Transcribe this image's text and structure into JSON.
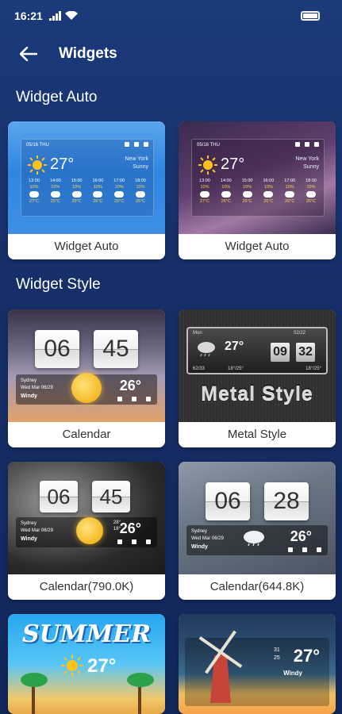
{
  "status_bar": {
    "time": "16:21"
  },
  "header": {
    "title": "Widgets"
  },
  "sections": {
    "widget_auto": {
      "title": "Widget Auto"
    },
    "widget_style": {
      "title": "Widget Style"
    }
  },
  "auto_cards": [
    {
      "label": "Widget Auto",
      "date": "05/16 THU",
      "temp": "27°",
      "city": "New York",
      "condition": "Sunny",
      "hours": [
        "13:00",
        "14:00",
        "15:00",
        "16:00",
        "17:00",
        "18:00"
      ],
      "pops": [
        "10%",
        "10%",
        "10%",
        "10%",
        "10%",
        "10%"
      ],
      "temps": [
        "27°C",
        "26°C",
        "26°C",
        "26°C",
        "26°C",
        "26°C"
      ]
    },
    {
      "label": "Widget Auto",
      "date": "05/16 THU",
      "temp": "27°",
      "city": "New York",
      "condition": "Sunny",
      "hours": [
        "13:00",
        "14:00",
        "15:00",
        "16:00",
        "17:00",
        "18:00"
      ],
      "pops": [
        "10%",
        "10%",
        "10%",
        "10%",
        "10%",
        "10%"
      ],
      "temps": [
        "27°C",
        "26°C",
        "26°C",
        "26°C",
        "26°C",
        "26°C"
      ]
    }
  ],
  "style_cards": [
    {
      "label": "Calendar",
      "hour": "06",
      "minute": "45",
      "location": "Sydney",
      "datetime": "Wed Mar 06/29",
      "weather": "Windy",
      "temp": "26°"
    },
    {
      "label": "Metal Style",
      "banner": "Metal Style",
      "top_left": "Mon",
      "top_right": "02/22",
      "temp": "27°",
      "hour": "09",
      "minute": "32",
      "low": "18°/25°",
      "low_right": "18°/25°",
      "hum": "62/33"
    },
    {
      "label": "Calendar(790.0K)",
      "hour": "06",
      "minute": "45",
      "location": "Sydney",
      "datetime": "Wed Mar 06/29",
      "weather": "Windy",
      "temp": "26°",
      "range_hi": "28°",
      "range_lo": "18°"
    },
    {
      "label": "Calendar(644.8K)",
      "hour": "06",
      "minute": "28",
      "location": "Sydney",
      "datetime": "Wed Mar 06/29",
      "weather": "Windy",
      "temp": "26°"
    },
    {
      "title": "SUMMER",
      "temp": "27°"
    },
    {
      "temp": "27°",
      "hi": "31",
      "lo": "25",
      "weather": "Windy"
    }
  ],
  "colors": {
    "background_top": "#1b3a7a",
    "background_bottom": "#12275a",
    "card_label_text": "#333333",
    "accent_sun": "#ffc21a"
  },
  "icons": [
    "back-arrow-icon",
    "wifi-icon",
    "signal-icon",
    "battery-icon",
    "sun-icon",
    "cloud-icon"
  ]
}
